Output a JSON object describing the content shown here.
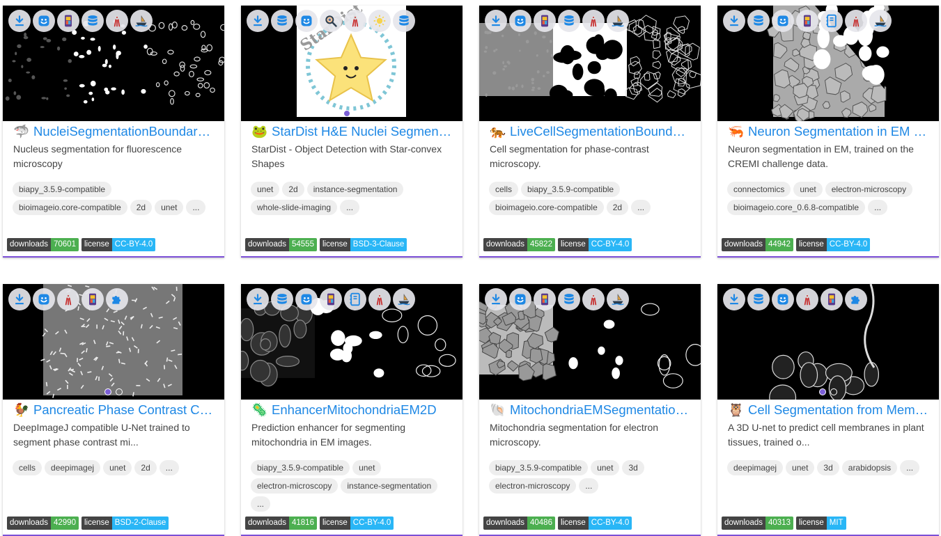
{
  "colors": {
    "accent": "#1e88e5",
    "downloads_value": "#4caf50",
    "license_value": "#29b6f6",
    "card_border": "#7b4fd6"
  },
  "cards": [
    {
      "emoji": "🦈",
      "title": "NucleiSegmentationBoundaryModel",
      "description": "Nucleus segmentation for fluorescence microscopy",
      "tags": [
        "biapy_3.5.9-compatible",
        "bioimageio.core-compatible",
        "2d",
        "unet",
        "..."
      ],
      "downloads_label": "downloads",
      "downloads": "70601",
      "license_label": "license",
      "license": "CC-BY-4.0",
      "icons": [
        "download-icon",
        "smiley-icon",
        "phone-app-icon",
        "database-icon",
        "ilastik-icon",
        "ship-icon"
      ]
    },
    {
      "emoji": "🐸",
      "title": "StarDist H&E Nuclei Segmentation",
      "description": "StarDist - Object Detection with Star-convex Shapes",
      "tags": [
        "unet",
        "2d",
        "instance-segmentation",
        "whole-slide-imaging",
        "..."
      ],
      "downloads_label": "downloads",
      "downloads": "54555",
      "license_label": "license",
      "license": "BSD-3-Clause",
      "thumb_text": "StarDist",
      "icons": [
        "download-icon",
        "database-icon",
        "smiley-icon",
        "magnifier-icon",
        "ilastik-icon",
        "sun-icon",
        "database-icon"
      ]
    },
    {
      "emoji": "🐅",
      "title": "LiveCellSegmentationBoundaryModel",
      "description": "Cell segmentation for phase-contrast microscopy.",
      "tags": [
        "cells",
        "biapy_3.5.9-compatible",
        "bioimageio.core-compatible",
        "2d",
        "..."
      ],
      "downloads_label": "downloads",
      "downloads": "45822",
      "license_label": "license",
      "license": "CC-BY-4.0",
      "icons": [
        "download-icon",
        "smiley-icon",
        "phone-app-icon",
        "database-icon",
        "ilastik-icon",
        "ship-icon"
      ]
    },
    {
      "emoji": "🦐",
      "title": "Neuron Segmentation in EM (Membrane Prediction)",
      "description": "Neuron segmentation in EM, trained on the CREMI challenge data.",
      "tags": [
        "connectomics",
        "unet",
        "electron-microscopy",
        "bioimageio.core_0.6.8-compatible",
        "..."
      ],
      "downloads_label": "downloads",
      "downloads": "44942",
      "license_label": "license",
      "license": "CC-BY-4.0",
      "icons": [
        "download-icon",
        "database-icon",
        "smiley-icon",
        "phone-app-icon",
        "notebook-icon",
        "ilastik-icon",
        "ship-icon"
      ]
    },
    {
      "emoji": "🐓",
      "title": "Pancreatic Phase Contrast Cell Segmentation (U-Net)",
      "description": "DeepImageJ compatible U-Net trained to segment phase contrast mi...",
      "tags": [
        "cells",
        "deepimagej",
        "unet",
        "2d",
        "..."
      ],
      "downloads_label": "downloads",
      "downloads": "42990",
      "license_label": "license",
      "license": "BSD-2-Clause",
      "icons": [
        "download-icon",
        "smiley-icon",
        "ilastik-icon",
        "phone-app-icon",
        "puzzle-icon"
      ]
    },
    {
      "emoji": "🦠",
      "title": "EnhancerMitochondriaEM2D",
      "description": "Prediction enhancer for segmenting mitochondria in EM images.",
      "tags": [
        "biapy_3.5.9-compatible",
        "unet",
        "electron-microscopy",
        "instance-segmentation",
        "..."
      ],
      "downloads_label": "downloads",
      "downloads": "41816",
      "license_label": "license",
      "license": "CC-BY-4.0",
      "icons": [
        "download-icon",
        "database-icon",
        "smiley-icon",
        "phone-app-icon",
        "notebook-icon",
        "ilastik-icon",
        "ship-icon"
      ]
    },
    {
      "emoji": "🐚",
      "title": "MitochondriaEMSegmentationBoundaryModel",
      "description": "Mitochondria segmentation for electron microscopy.",
      "tags": [
        "biapy_3.5.9-compatible",
        "unet",
        "3d",
        "electron-microscopy",
        "..."
      ],
      "downloads_label": "downloads",
      "downloads": "40486",
      "license_label": "license",
      "license": "CC-BY-4.0",
      "icons": [
        "download-icon",
        "smiley-icon",
        "phone-app-icon",
        "database-icon",
        "ilastik-icon",
        "ship-icon"
      ]
    },
    {
      "emoji": "🦉",
      "title": "Cell Segmentation from Membranes",
      "description": "A 3D U-net to predict cell membranes in plant tissues, trained o...",
      "tags": [
        "deepimagej",
        "unet",
        "3d",
        "arabidopsis",
        "..."
      ],
      "downloads_label": "downloads",
      "downloads": "40313",
      "license_label": "license",
      "license": "MIT",
      "icons": [
        "download-icon",
        "database-icon",
        "smiley-icon",
        "ilastik-icon",
        "phone-app-icon",
        "puzzle-icon"
      ]
    }
  ]
}
